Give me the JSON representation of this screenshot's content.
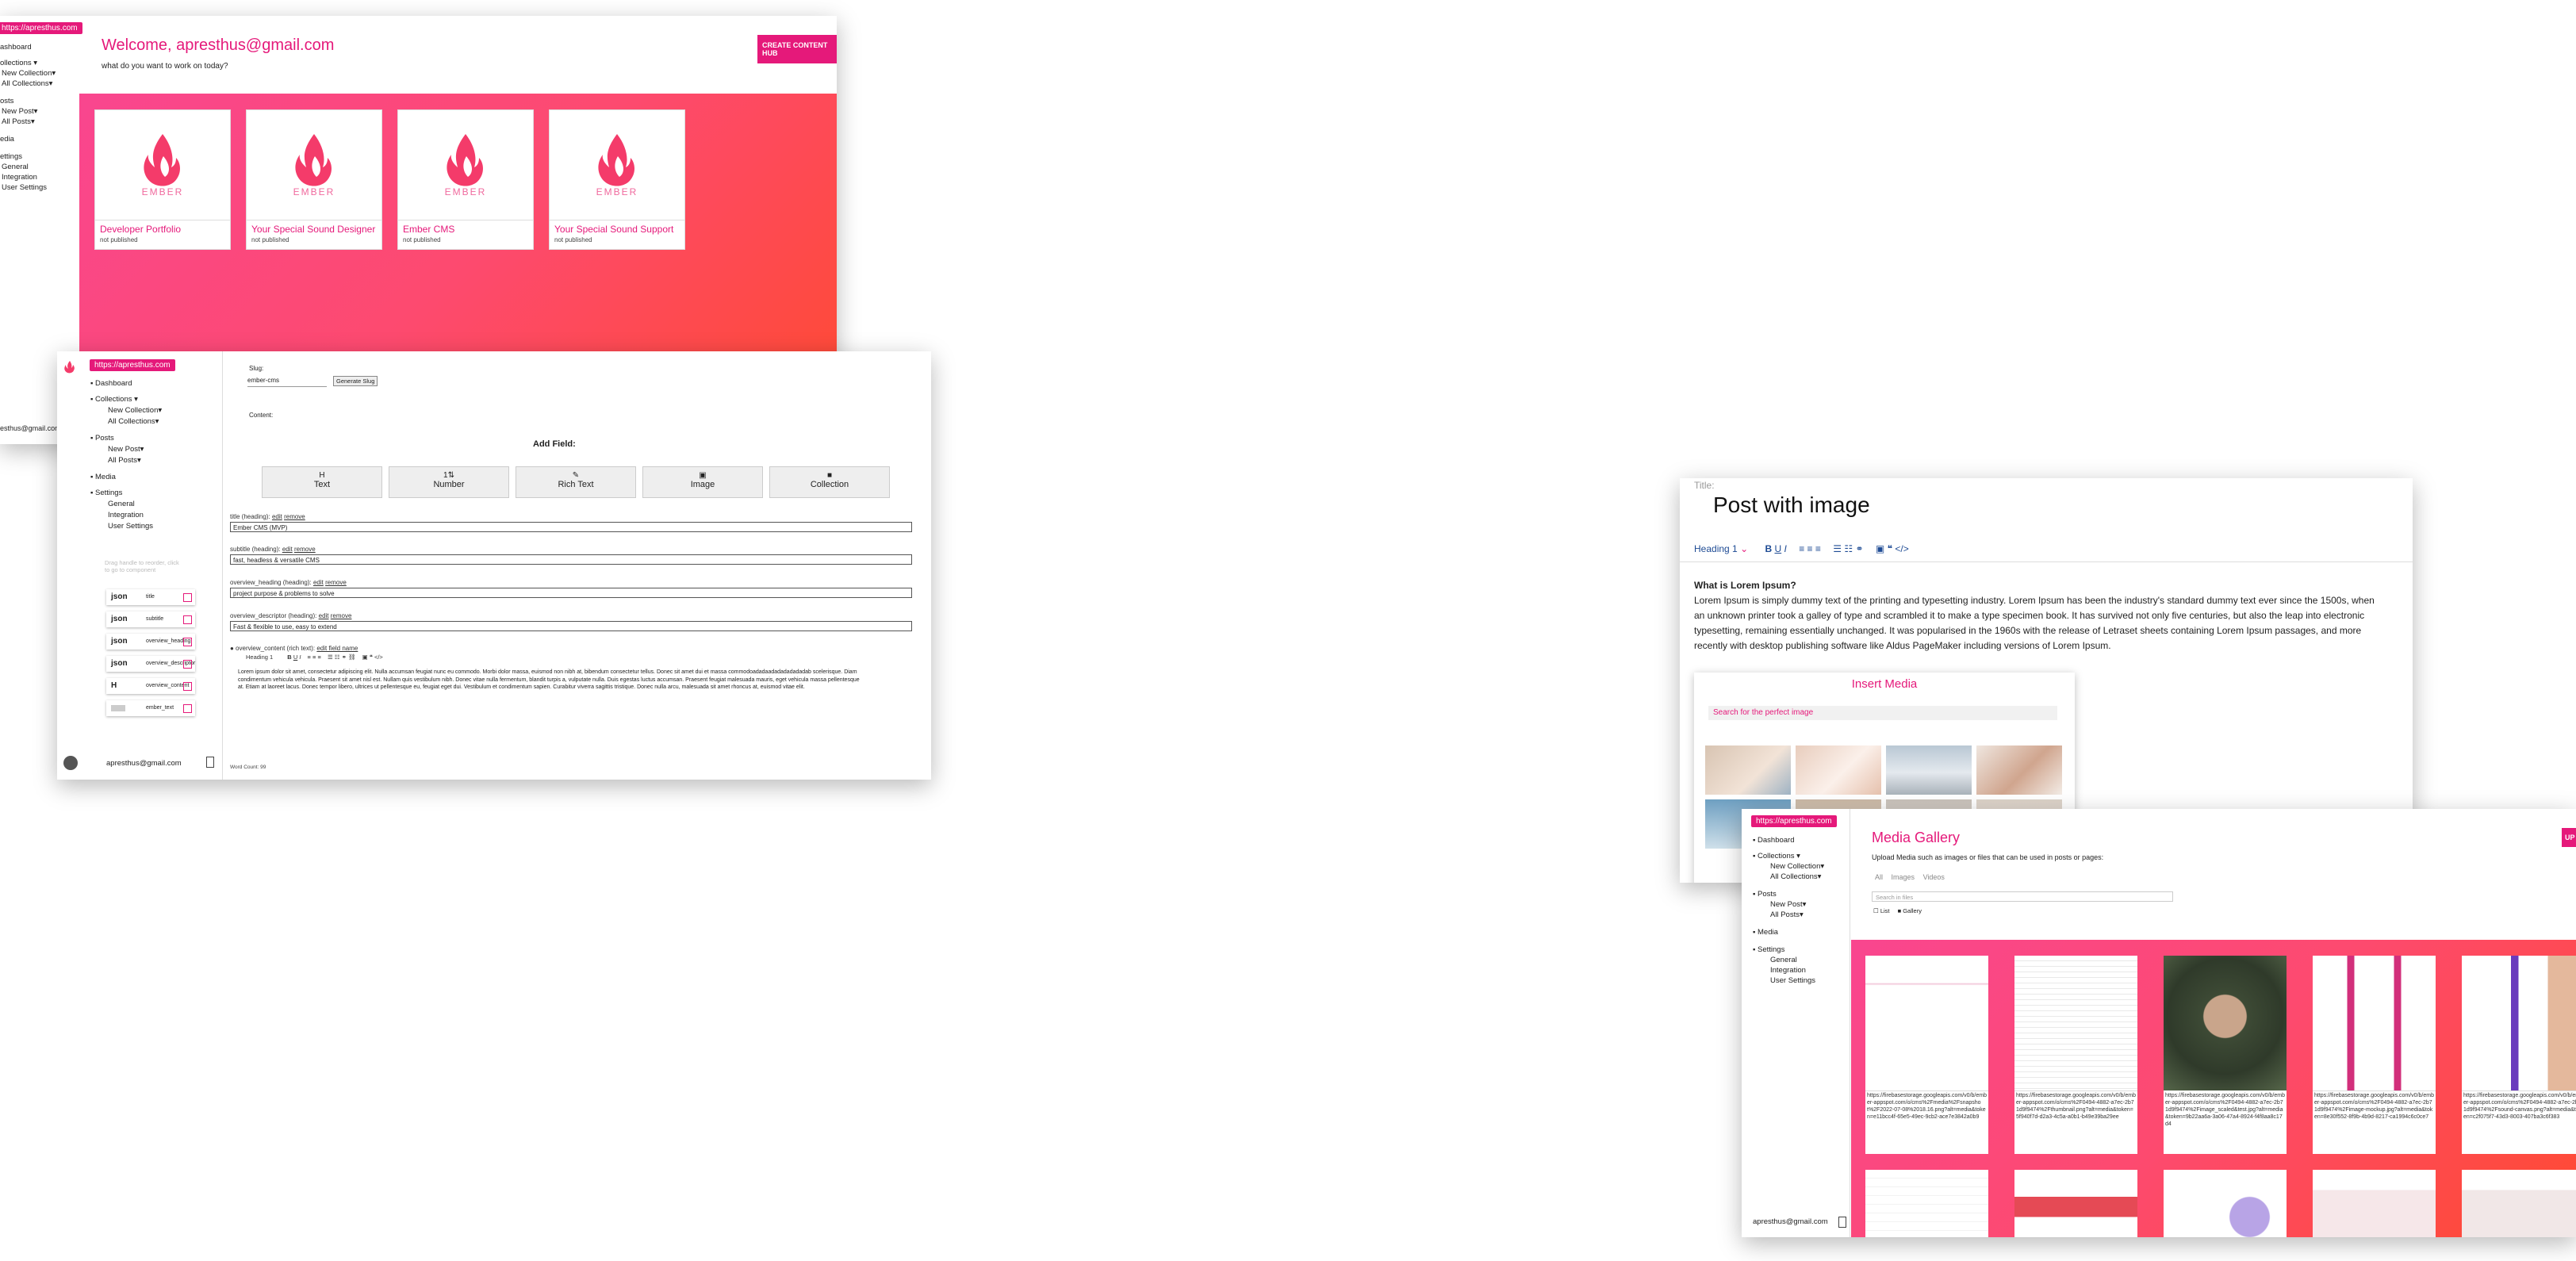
{
  "dashboard": {
    "url_pill": "https://apresthus.com",
    "welcome": "Welcome, apresthus@gmail.com",
    "subtitle": "what do you want to work on today?",
    "create_button": "CREATE CONTENT HUB",
    "nav": [
      "ashboard",
      "ollections ▾",
      "New Collection▾",
      "All Collections▾",
      "osts",
      "New Post▾",
      "All Posts▾",
      "edia",
      "ettings",
      "General",
      "Integration",
      "User Settings"
    ],
    "user_email": "esthus@gmail.com",
    "logo_word": "EMBER",
    "cards": [
      {
        "title": "Developer Portfolio",
        "status": "not published"
      },
      {
        "title": "Your Special Sound Designer",
        "status": "not published"
      },
      {
        "title": "Ember CMS",
        "status": "not published"
      },
      {
        "title": "Your Special Sound Support",
        "status": "not published"
      }
    ]
  },
  "editor": {
    "url_pill": "https://apresthus.com",
    "nav": [
      "Dashboard",
      "Collections ▾",
      "New Collection▾",
      "All Collections▾",
      "Posts",
      "New Post▾",
      "All Posts▾",
      "Media",
      "Settings",
      "General",
      "Integration",
      "User Settings"
    ],
    "slug_label": "Slug:",
    "slug_value": "ember-cms",
    "generate_slug": "Generate Slug",
    "content_label": "Content:",
    "add_field": "Add Field:",
    "field_types": [
      {
        "icon": "H",
        "label": "Text"
      },
      {
        "icon": "1⇅",
        "label": "Number"
      },
      {
        "icon": "✎",
        "label": "Rich Text"
      },
      {
        "icon": "▣",
        "label": "Image"
      },
      {
        "icon": "■",
        "label": "Collection"
      }
    ],
    "fields": [
      {
        "label": "title (heading):",
        "edit": "edit",
        "remove": "remove",
        "value": "Ember CMS (MVP)"
      },
      {
        "label": "subtitle (heading):",
        "edit": "edit",
        "remove": "remove",
        "value": "fast, headless & versatile CMS"
      },
      {
        "label": "overview_heading (heading):",
        "edit": "edit",
        "remove": "remove",
        "value": "project purpose & problems to solve"
      },
      {
        "label": "overview_descriptor (heading):",
        "edit": "edit",
        "remove": "remove",
        "value": "Fast & flexible to use, easy to extend"
      }
    ],
    "richtext_label": "● overview_content (rich text):",
    "richtext_edit": "edit field name",
    "heading_select": "Heading 1",
    "lorem": "Lorem ipsum dolor sit amet, consectetur adipiscing elit. Nulla accumsan feugiat nunc eu commodo. Morbi dolor massa, euismod non nibh at, bibendum consectetur tellus. Donec sit amet dui et massa commodoadadaadadadadadadab scelerisque. Diam condimentum vehicula vehicula. Praesent sit amet nisl est. Nullam quis vestibulum nibh. Donec vitae nulla fermentum, blandit turpis a, vulputate nulla. Duis egestas luctus accumsan. Praesent feugiat malesuada mauris, eget vehicula massa pellentesque at. Etiam at laoreet lacus. Donec tempor libero, ultrices ut pellentesque eu, feugiat eget dui. Vestibulum et condimentum sapien. Curabitur viverra sagittis tristique. Donec nulla arcu, malesuada sit amet rhoncus at, euismod vitae elit.",
    "word_count": "Word Count: 99",
    "drag_hint": "Drag handle to reorder, click to go to component",
    "components": [
      {
        "kind": "json",
        "name": "title"
      },
      {
        "kind": "json",
        "name": "subtitle"
      },
      {
        "kind": "json",
        "name": "overview_heading"
      },
      {
        "kind": "json",
        "name": "overview_descriptor"
      },
      {
        "kind": "H",
        "name": "overview_content"
      },
      {
        "kind": "",
        "name": "ember_text"
      }
    ],
    "user_email": "apresthus@gmail.com"
  },
  "post": {
    "title_label": "Title:",
    "title": "Post with image",
    "heading_select": "Heading 1",
    "question": "What is Lorem Ipsum?",
    "body": "Lorem Ipsum is simply dummy text of the printing and typesetting industry. Lorem Ipsum has been the industry's standard dummy text ever since the 1500s, when an unknown printer took a galley of type and scrambled it to make a type specimen book. It has survived not only five centuries, but also the leap into electronic typesetting, remaining essentially unchanged. It was popularised in the 1960s with the release of Letraset sheets containing Lorem Ipsum passages, and more recently with desktop publishing software like Aldus PageMaker including versions of Lorem Ipsum.",
    "insert_media": "Insert Media",
    "search_placeholder": "Search for the perfect image"
  },
  "gallery": {
    "url_pill": "https://apresthus.com",
    "nav": [
      "Dashboard",
      "Collections ▾",
      "New Collection▾",
      "All Collections▾",
      "Posts",
      "New Post▾",
      "All Posts▾",
      "Media",
      "Settings",
      "General",
      "Integration",
      "User Settings"
    ],
    "title": "Media Gallery",
    "subtitle": "Upload Media such as images or files that can be used in posts or pages:",
    "tabs": [
      "All",
      "Images",
      "Videos"
    ],
    "search_placeholder": "Search in files",
    "view_list": "List",
    "view_gallery": "Gallery",
    "upload_label": "UP",
    "user_email": "apresthus@gmail.com",
    "items": [
      {
        "url": "https://firebasestorage.googleapis.com/v0/b/ember-appspot.com/o/cms%2Fmedia%2Fsnapshot%2F2022-07-08%2018.16.png?alt=media&token=e11bcc4f-65e5-49ec-9cb2-ace7e3842a0b9"
      },
      {
        "url": "https://firebasestorage.googleapis.com/v0/b/ember-appspot.com/o/cms%2F0494-4882-a7ec-2b71d9f9474%2Fthumbnail.png?alt=media&token=5f940f7d-d2a3-4c5a-a0b1-b49e39ba29ee"
      },
      {
        "url": "https://firebasestorage.googleapis.com/v0/b/ember-appspot.com/o/cms%2F0494-4882-a7ec-2b71d9f9474%2Fimage_scaled&test.jpg?alt=media&token=9b22aa6a-3a06-47a4-8924-f4f8aa8c17d4"
      },
      {
        "url": "https://firebasestorage.googleapis.com/v0/b/ember-appspot.com/o/cms%2F0494-4882-a7ec-2b71d9f9474%2Fimage-mockup.jpg?alt=media&token=8e30f552-8f9b-4b9d-8217-ca1994c6c0ce7"
      },
      {
        "url": "https://firebasestorage.googleapis.com/v0/b/ember-appspot.com/o/cms%2F0494-4882-a7ec-2b71d9f9474%2Fsound-canvas.png?alt=media&token=c2f075f7-43d3-8003-407ba3c6f383"
      }
    ]
  }
}
